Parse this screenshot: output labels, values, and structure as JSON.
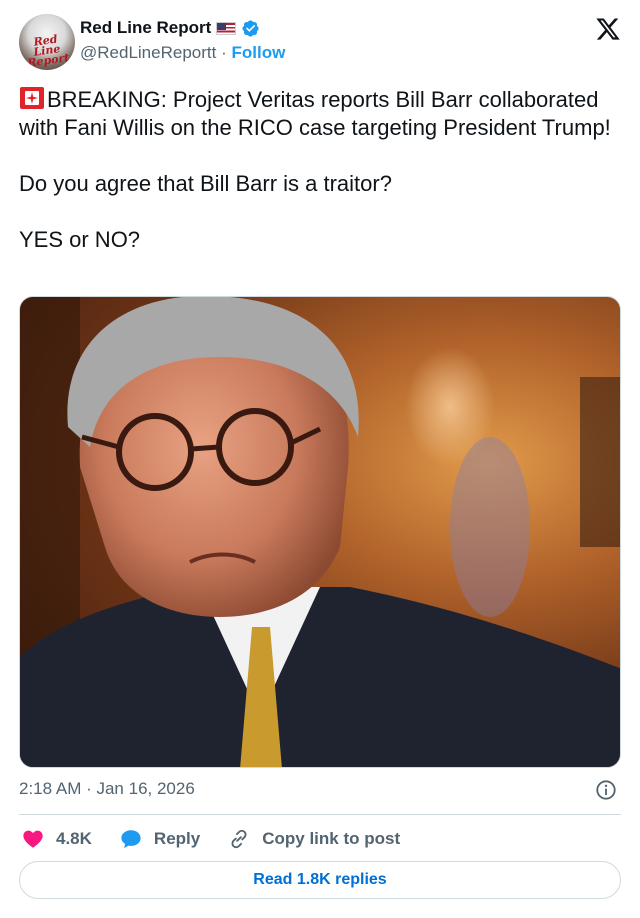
{
  "author": {
    "display_name": "Red Line Report",
    "handle": "@RedLineReportt",
    "separator": "·",
    "follow_label": "Follow",
    "avatar_text": "Red Line Report"
  },
  "tweet": {
    "line1": "BREAKING: Project Veritas reports Bill Barr collaborated with Fani Willis on the RICO case targeting President Trump!",
    "line2": "Do you agree that Bill Barr is a traitor?",
    "line3": "YES or NO?"
  },
  "meta": {
    "timestamp": "2:18 AM · Jan 16, 2026"
  },
  "actions": {
    "likes": "4.8K",
    "reply_label": "Reply",
    "copy_label": "Copy link to post"
  },
  "replies_button": "Read 1.8K replies",
  "colors": {
    "accent": "#1d9bf0",
    "like": "#f91880",
    "muted": "#536471",
    "text": "#0f1419"
  }
}
